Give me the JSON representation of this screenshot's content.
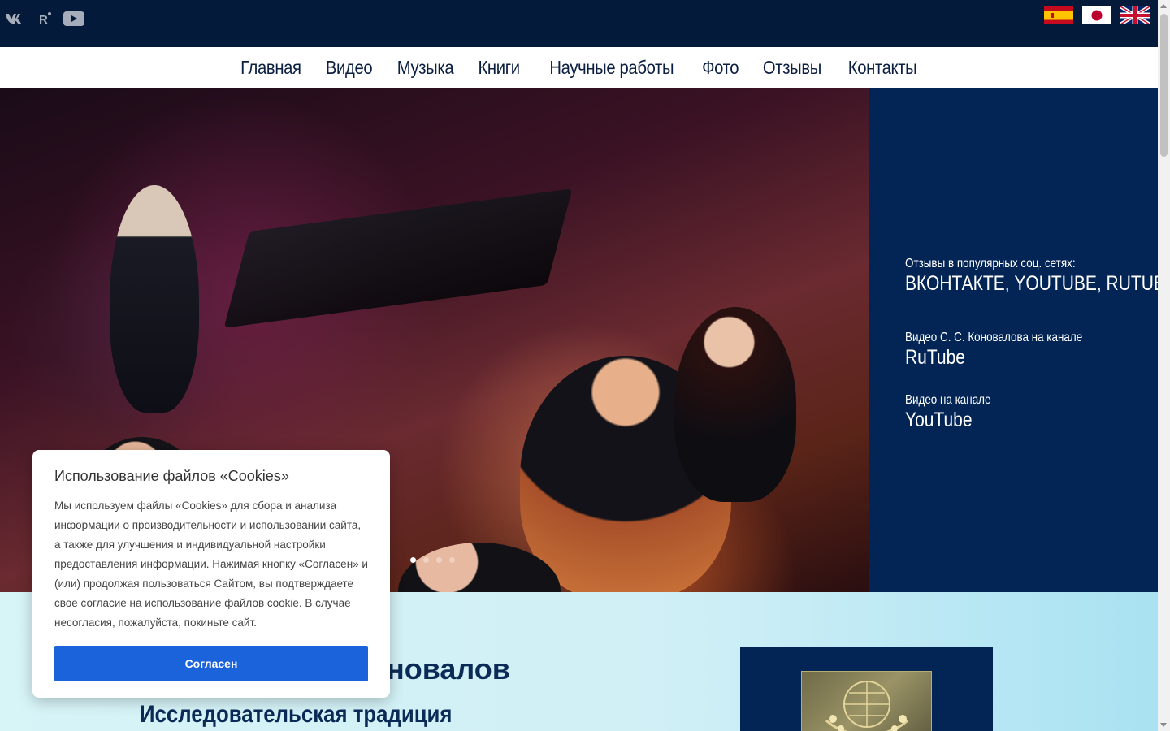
{
  "social": {
    "icons": [
      "vk-icon",
      "rutube-icon",
      "youtube-icon"
    ]
  },
  "languages": [
    "spanish-flag-icon",
    "japanese-flag-icon",
    "uk-flag-icon"
  ],
  "nav": {
    "items": [
      "Главная",
      "Видео",
      "Музыка",
      "Книги",
      "Научные работы",
      "Фото",
      "Отзывы",
      "Контакты"
    ]
  },
  "hero": {
    "slides_total": 4,
    "active_slide": 1
  },
  "side": {
    "review_small": "Отзывы в популярных соц. сетях:",
    "review_big": "ВКОНТАКТЕ, YOUTUBE, RUTUBE",
    "rutube_small": "Видео С. С. Коновалова на канале",
    "rutube_big": "RuTube",
    "youtube_small": "Видео на канале",
    "youtube_big": "YouTube"
  },
  "lower": {
    "name_visible": "оновалов",
    "subtitle": "Исследовательская традиция"
  },
  "cookie": {
    "title": "Использование файлов «Cookies»",
    "text": "Мы используем файлы «Cookies» для сбора и анализа информации о производительности и использовании сайта, а также для улучшения и индивидуальной настройки предоставления информации. Нажимая кнопку «Согласен» и (или) продолжая пользоваться Сайтом, вы подтверждаете свое согласие на использование файлов cookie. В случае несогласия, пожалуйста, покиньте сайт.",
    "button": "Согласен"
  },
  "colors": {
    "topbar": "#031a3a",
    "panel": "#032555",
    "accent_button": "#1a63db"
  }
}
